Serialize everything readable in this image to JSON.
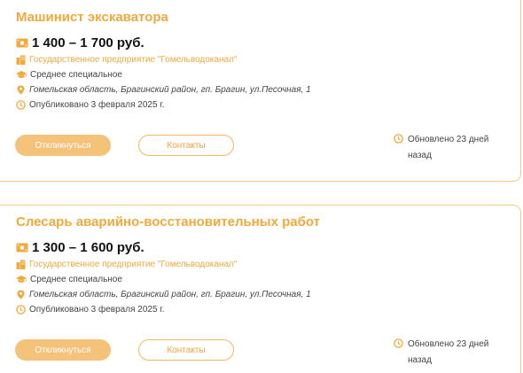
{
  "colors": {
    "accent": "#f2a93b",
    "button_fill": "#f5c27a",
    "border": "#f1c98a"
  },
  "vacancies": [
    {
      "title": "Машинист экскаватора",
      "salary": "1 400 – 1 700 руб.",
      "company": "Государственное предприятие \"Гомельводоканал\"",
      "education": "Среднее специальное",
      "address": "Гомельская область, Брагинский район, гп. Брагин, ул.Песочная, 1",
      "published": "Опубликовано 3 февраля 2025 г.",
      "apply_label": "Откликнуться",
      "contacts_label": "Контакты",
      "updated_line1": "Обновлено 23 дней",
      "updated_line2": "назад"
    },
    {
      "title": "Слесарь аварийно-восстановительных работ",
      "salary": "1 300 – 1 600 руб.",
      "company": "Государственное предприятие \"Гомельводоканал\"",
      "education": "Среднее специальное",
      "address": "Гомельская область, Брагинский район, гп. Брагин, ул.Песочная, 1",
      "published": "Опубликовано 3 февраля 2025 г.",
      "apply_label": "Откликнуться",
      "contacts_label": "Контакты",
      "updated_line1": "Обновлено 23 дней",
      "updated_line2": "назад"
    }
  ],
  "icons": [
    "money-icon",
    "building-icon",
    "graduation-cap-icon",
    "location-pin-icon",
    "clock-icon"
  ]
}
